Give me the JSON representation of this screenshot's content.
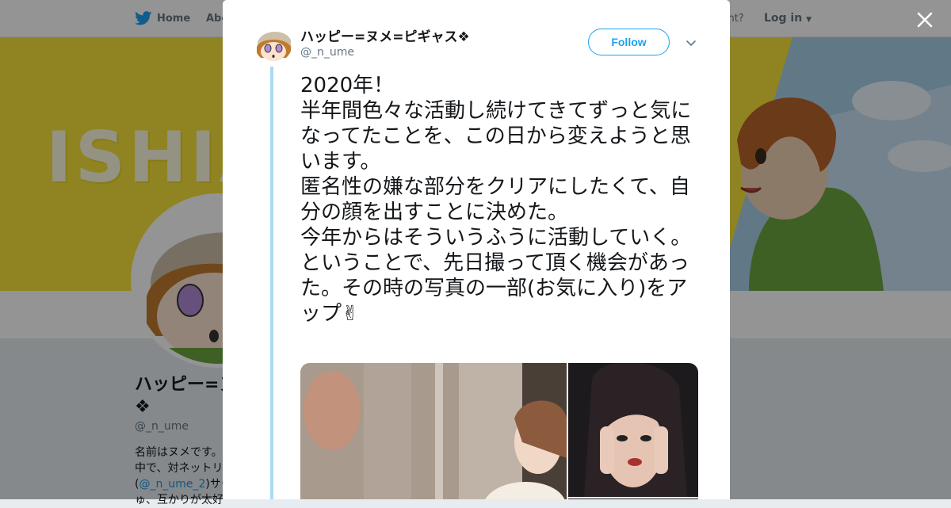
{
  "nav": {
    "home": "Home",
    "about": "Abo",
    "have_account": "account?",
    "login": "Log in"
  },
  "banner": {
    "text": "ISHIA"
  },
  "profile": {
    "name_line1": "ハッピー=ヌ",
    "name_line2": "❖",
    "handle": "@_n_ume",
    "bio_line1": "名前はヌメです。",
    "bio_line2": "中で、対ネットリ",
    "bio_line3_link": "@_n_ume_2",
    "bio_line3_rest": ")サー",
    "bio_line4": "ゅ、互かりが太好"
  },
  "tweet": {
    "name": "ハッピー=ヌメ=ピギャス❖",
    "handle": "@_n_ume",
    "follow_label": "Follow",
    "text": "2020年！\n半年間色々な活動し続けてきてずっと気になってたことを、この日から変えようと思います。\n匿名性の嫌な部分をクリアにしたくて、自分の顔を出すことに決めた。\n今年からはそういうふうに活動していく。\nということで、先日撮って頂く機会があった。その時の写真の一部(お気に入り)をアップ✌"
  },
  "icons": {
    "bird": "twitter-bird-icon",
    "close": "close-icon",
    "caret": "chevron-down-icon"
  },
  "colors": {
    "accent": "#1da1f2",
    "banner": "#f7e33a",
    "thread": "#a9dcf3"
  }
}
